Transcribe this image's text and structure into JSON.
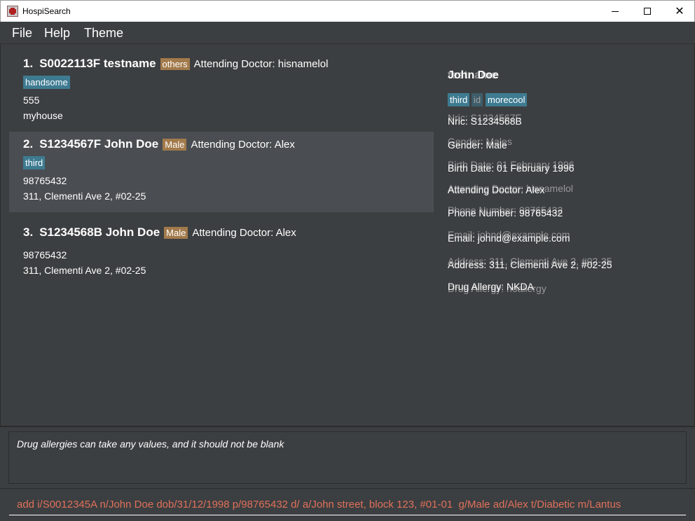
{
  "window": {
    "title": "HospiSearch"
  },
  "menu": {
    "items": [
      "File",
      "Help",
      "Theme"
    ]
  },
  "patients": [
    {
      "index": "1.",
      "id_name": "S0022113F testname",
      "gender": "others",
      "doctor": "Attending Doctor: hisnamelol",
      "tag": "handsome",
      "phone": "555",
      "address": "myhouse"
    },
    {
      "index": "2.",
      "id_name": "S1234567F John Doe",
      "gender": "Male",
      "doctor": "Attending Doctor: Alex",
      "tag": "third",
      "phone": "98765432",
      "address": "311, Clementi Ave 2, #02-25"
    },
    {
      "index": "3.",
      "id_name": "S1234568B John Doe",
      "gender": "Male",
      "doctor": "Attending Doctor: Alex",
      "phone": "98765432",
      "address": "311, Clementi Ave 2, #02-25"
    }
  ],
  "details": {
    "name": "John Doe",
    "name_overlap": "testname",
    "tags": [
      "third",
      "id",
      "morecool"
    ],
    "nric": "Nric: S1234568B",
    "nric_faint": "Nric: S1234567F",
    "gender": "Gender: Male",
    "gender_faint": "Gender: Males",
    "dob": "Birth Date: 01 February 1996",
    "dob_faint": "Birth Date: 01 February 1996",
    "doctor": "Attending Doctor: Alex",
    "doctor_faint": "Attending Doctor: hisnamelol",
    "phone": "Phone Number: 98765432",
    "phone_faint": "Phone Number: 98765432",
    "email": "Email: johnd@example.com",
    "email_faint": "Email: johnd@example.com",
    "address": "Address: 311, Clementi Ave 2, #02-25",
    "address_faint": "Address: 311, Clementi Ave 2, #02-35",
    "allergy": "Drug Allergy: NKDA",
    "allergy_faint": "Drug Allergy: noallergy"
  },
  "result": {
    "message": "Drug allergies can take any values, and it should not be blank"
  },
  "command": {
    "value": "add i/S0012345A n/John Doe dob/31/12/1998 p/98765432 d/ a/John street, block 123, #01-01  g/Male ad/Alex t/Diabetic m/Lantus"
  }
}
